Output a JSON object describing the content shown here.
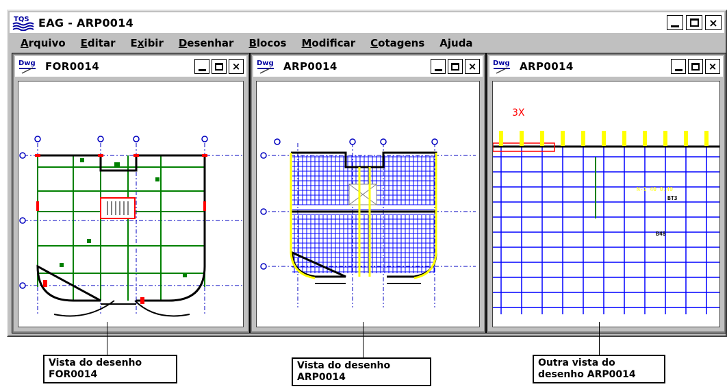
{
  "window": {
    "title": "EAG - ARP0014",
    "buttons": {
      "minimize": "_",
      "maximize": "□",
      "close": "×"
    },
    "icon": "tqs-logo-icon"
  },
  "menu": [
    {
      "label": "Arquivo",
      "accel": "A",
      "rest": "rquivo"
    },
    {
      "label": "Editar",
      "accel": "E",
      "rest": "ditar"
    },
    {
      "label": "Exibir",
      "accel": "E",
      "rest": "xibir",
      "pre": "",
      "underline_index": 1
    },
    {
      "label": "Desenhar",
      "accel": "D",
      "rest": "esenhar"
    },
    {
      "label": "Blocos",
      "accel": "B",
      "rest": "locos"
    },
    {
      "label": "Modificar",
      "accel": "M",
      "rest": "odificar"
    },
    {
      "label": "Cotagens",
      "accel": "C",
      "rest": "otagens"
    },
    {
      "label": "Ajuda",
      "accel": "",
      "rest": "Ajuda"
    }
  ],
  "children": [
    {
      "name": "FOR0014",
      "icon": "dwg-icon",
      "close": "×"
    },
    {
      "name": "ARP0014",
      "icon": "dwg-icon",
      "close": "×"
    },
    {
      "name": "ARP0014",
      "icon": "dwg-icon",
      "close": "×"
    }
  ],
  "drawing3": {
    "label": "3X",
    "dim1": "N-1 40 0.40",
    "dim2": "BT3",
    "dim3": "B48"
  },
  "callouts": [
    {
      "line1": "Vista do desenho",
      "line2": "FOR0014"
    },
    {
      "line1": "Vista do desenho",
      "line2": "ARP0014"
    },
    {
      "line1": "Outra vista do",
      "line2": "desenho ARP0014"
    }
  ],
  "colors": {
    "chrome": "#c0c0c0",
    "grid_green": "#008000",
    "grid_blue": "#0000ff",
    "grid_yellow": "#ffff00",
    "axis_blue": "#0000c0",
    "red": "#ff0000"
  }
}
